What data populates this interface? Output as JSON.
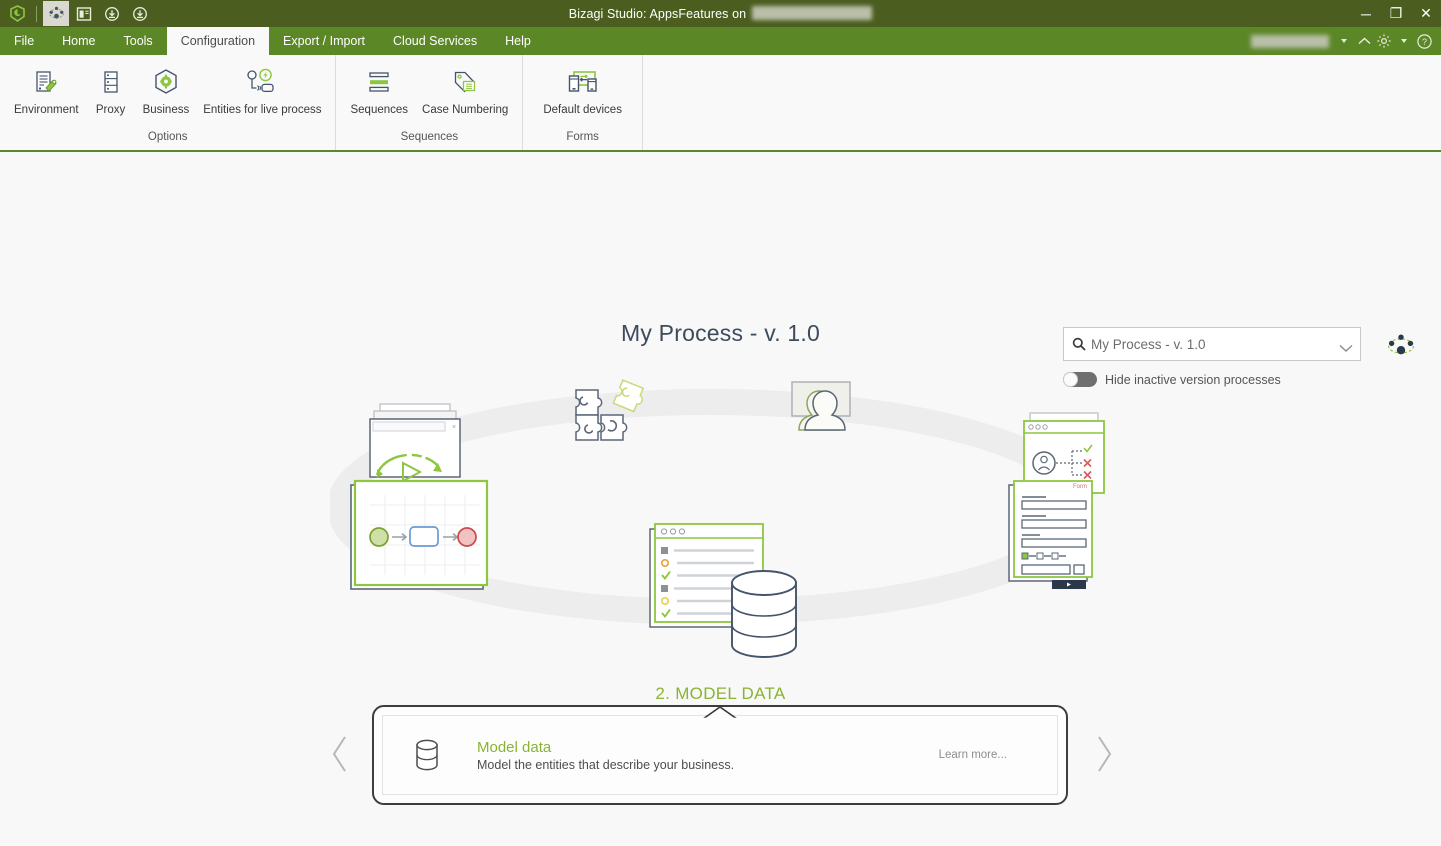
{
  "titlebar": {
    "app_title": "Bizagi Studio: AppsFeatures  on",
    "redacted_suffix": "",
    "quick_access": [
      {
        "name": "bizagi-logo-icon",
        "label": "Bizagi"
      },
      {
        "name": "process-wheel-icon",
        "label": "Process"
      },
      {
        "name": "window-layout-icon",
        "label": "Layout"
      },
      {
        "name": "download-icon-1",
        "label": "Download"
      },
      {
        "name": "download-icon-2",
        "label": "Download"
      }
    ],
    "window_controls": {
      "minimize": "─",
      "restore": "❐",
      "close": "✕"
    }
  },
  "menubar": {
    "items": [
      {
        "label": "File",
        "active": false
      },
      {
        "label": "Home",
        "active": false
      },
      {
        "label": "Tools",
        "active": false
      },
      {
        "label": "Configuration",
        "active": true
      },
      {
        "label": "Export / Import",
        "active": false
      },
      {
        "label": "Cloud Services",
        "active": false
      },
      {
        "label": "Help",
        "active": false
      }
    ],
    "right": {
      "user_label": "",
      "collapse_ribbon": "collapse-ribbon-icon",
      "settings": "gear-icon",
      "help": "help-circle-icon"
    }
  },
  "ribbon": {
    "groups": [
      {
        "label": "Options",
        "buttons": [
          {
            "label": "Environment",
            "icon": "environment-icon"
          },
          {
            "label": "Proxy",
            "icon": "proxy-server-icon"
          },
          {
            "label": "Business",
            "icon": "business-gear-icon"
          },
          {
            "label": "Entities for live process",
            "icon": "live-entities-icon"
          }
        ]
      },
      {
        "label": "Sequences",
        "buttons": [
          {
            "label": "Sequences",
            "icon": "sequences-icon"
          },
          {
            "label": "Case Numbering",
            "icon": "case-numbering-icon"
          }
        ]
      },
      {
        "label": "Forms",
        "buttons": [
          {
            "label": "Default devices",
            "icon": "default-devices-icon"
          }
        ]
      }
    ]
  },
  "main": {
    "page_title": "My Process - v. 1.0",
    "search": {
      "value": "My Process - v. 1.0",
      "placeholder": "My Process - v. 1.0",
      "icon": "search-icon",
      "dropdown_icon": "chevron-down-icon"
    },
    "toggle": {
      "label": "Hide inactive version processes",
      "checked": false
    },
    "network_icon": "network-nodes-icon",
    "step": {
      "label": "2. MODEL DATA",
      "card": {
        "icon": "database-cylinder-icon",
        "title": "Model data",
        "description": "Model the entities that describe your business.",
        "learn_more": "Learn more..."
      }
    },
    "nav": {
      "prev_icon": "chevron-left-icon",
      "next_icon": "chevron-right-icon"
    }
  },
  "colors": {
    "titlebar_bg": "#4b5e20",
    "ribbon_accent": "#5c8727",
    "brand_green": "#8ab431",
    "content_bg": "#f8f8f8",
    "heading_blue": "#3d4b5c",
    "outline_navy": "#44546a"
  }
}
